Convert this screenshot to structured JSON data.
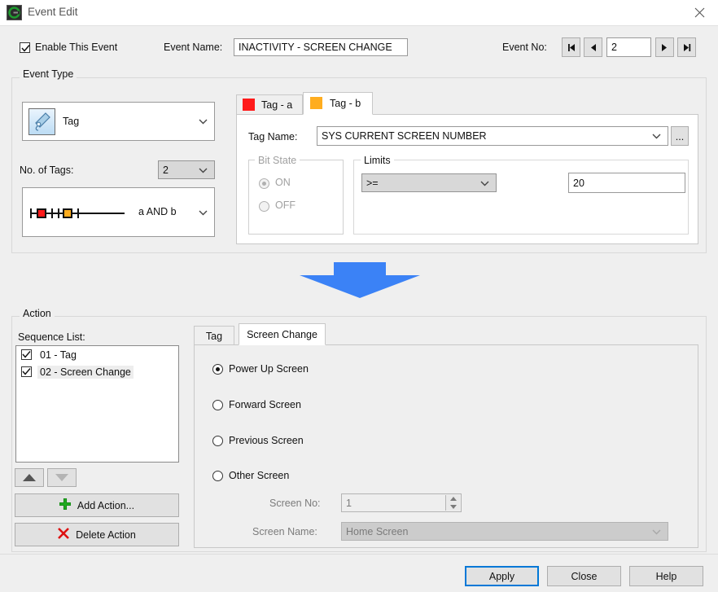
{
  "window": {
    "title": "Event Edit",
    "app_icon": "app-logo-icon",
    "close_icon": "close-icon"
  },
  "header": {
    "enable_checkbox_label": "Enable This Event",
    "enable_checked": true,
    "event_name_label": "Event Name:",
    "event_name_value": "INACTIVITY - SCREEN CHANGE",
    "event_no_label": "Event No:",
    "event_no_value": "2",
    "nav_first_icon": "first-record-icon",
    "nav_prev_icon": "previous-record-icon",
    "nav_next_icon": "next-record-icon",
    "nav_last_icon": "last-record-icon"
  },
  "event_type": {
    "group_title": "Event Type",
    "type_value": "Tag",
    "type_icon": "tag-icon",
    "no_of_tags_label": "No. of Tags:",
    "no_of_tags_value": "2",
    "logic_value": "a AND b",
    "logic_icon": "ladder-contacts-series-icon",
    "tabs": [
      {
        "label": "Tag - a",
        "color": "#ff1a1a",
        "active": false
      },
      {
        "label": "Tag - b",
        "color": "#ffad1f",
        "active": true
      }
    ],
    "tag_name_label": "Tag Name:",
    "tag_name_value": "SYS CURRENT SCREEN NUMBER",
    "browse_label": "...",
    "bit_state": {
      "group_title": "Bit State",
      "enabled": false,
      "options": [
        "ON",
        "OFF"
      ],
      "selected": "ON"
    },
    "limits": {
      "group_title": "Limits",
      "operator_value": ">=",
      "operator_options": [
        ">=",
        ">",
        "=",
        "<",
        "<=",
        "<>"
      ],
      "value": "20"
    }
  },
  "flow_arrow_color": "#3b82f6",
  "action": {
    "group_title": "Action",
    "sequence_list_label": "Sequence List:",
    "sequence_items": [
      {
        "label": "01 - Tag",
        "checked": true,
        "selected": false
      },
      {
        "label": "02 - Screen Change",
        "checked": true,
        "selected": true
      }
    ],
    "move_up_icon": "move-up-icon",
    "move_down_icon": "move-down-icon",
    "move_up_enabled": true,
    "move_down_enabled": false,
    "add_action_label": "Add Action...",
    "add_action_icon": "plus-icon",
    "delete_action_label": "Delete Action",
    "delete_action_icon": "x-mark-icon",
    "tabs": [
      {
        "label": "Tag",
        "active": false
      },
      {
        "label": "Screen Change",
        "active": true
      }
    ],
    "screen_change": {
      "options": [
        {
          "label": "Power Up Screen",
          "selected": true
        },
        {
          "label": "Forward Screen",
          "selected": false
        },
        {
          "label": "Previous Screen",
          "selected": false
        },
        {
          "label": "Other Screen",
          "selected": false
        }
      ],
      "screen_no_label": "Screen No:",
      "screen_no_value": "1",
      "screen_no_enabled": false,
      "screen_name_label": "Screen Name:",
      "screen_name_value": "Home Screen",
      "screen_name_enabled": false
    }
  },
  "footer": {
    "apply_label": "Apply",
    "close_label": "Close",
    "help_label": "Help"
  }
}
